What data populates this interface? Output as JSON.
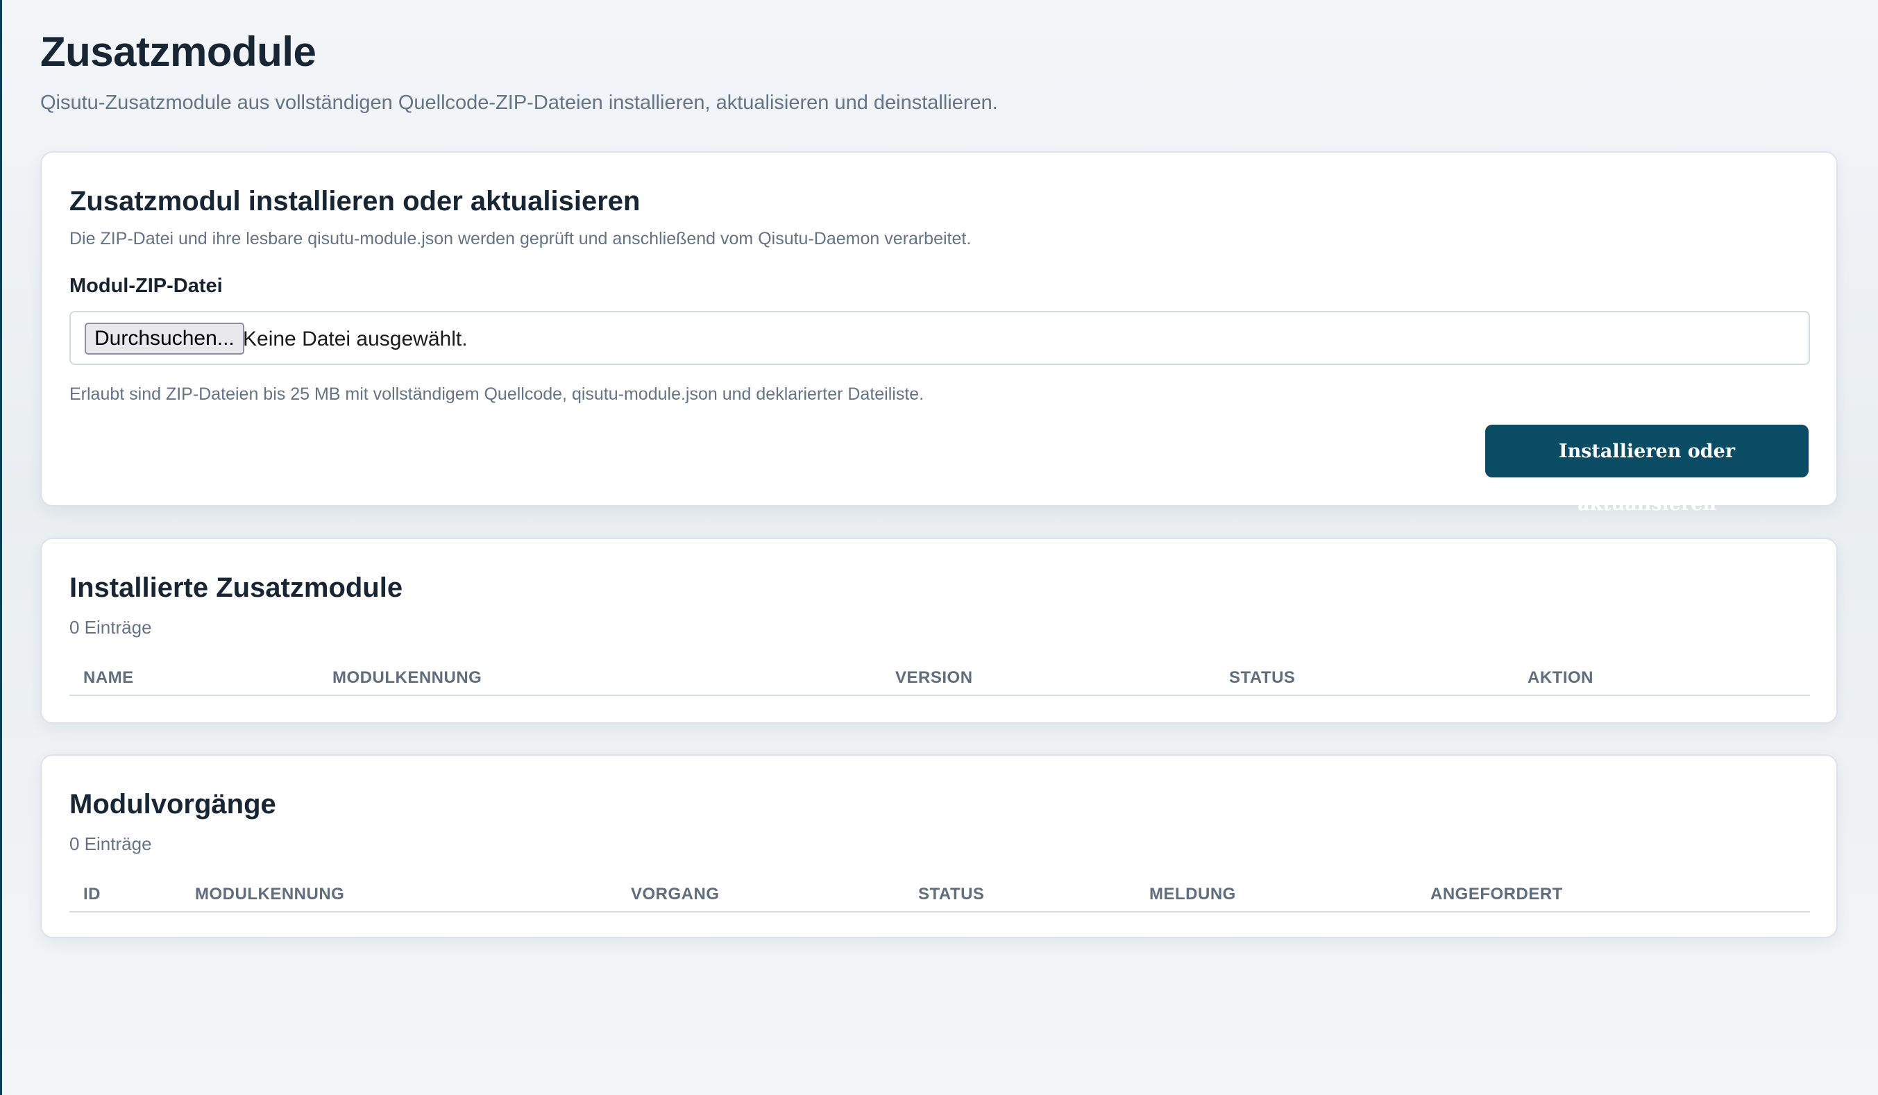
{
  "page": {
    "title": "Zusatzmodule",
    "subtitle": "Qisutu-Zusatzmodule aus vollständigen Quellcode-ZIP-Dateien installieren, aktualisieren und deinstallieren."
  },
  "install": {
    "title": "Zusatzmodul installieren oder aktualisieren",
    "description": "Die ZIP-Datei und ihre lesbare qisutu-module.json werden geprüft und anschließend vom Qisutu-Daemon verarbeitet.",
    "field_label": "Modul-ZIP-Datei",
    "browse_label": "Durchsuchen...",
    "file_status": "Keine Datei ausgewählt.",
    "hint": "Erlaubt sind ZIP-Dateien bis 25 MB mit vollständigem Quellcode, qisutu-module.json und deklarierter Dateiliste.",
    "submit_label": "Installieren oder aktualisieren"
  },
  "installed": {
    "title": "Installierte Zusatzmodule",
    "count": "0 Einträge",
    "columns": [
      "NAME",
      "MODULKENNUNG",
      "VERSION",
      "STATUS",
      "AKTION"
    ],
    "rows": []
  },
  "operations": {
    "title": "Modulvorgänge",
    "count": "0 Einträge",
    "columns": [
      "ID",
      "MODULKENNUNG",
      "VORGANG",
      "STATUS",
      "MELDUNG",
      "ANGEFORDERT"
    ],
    "rows": []
  },
  "colors": {
    "accent": "#094c64",
    "background": "#eef2f5",
    "card": "#ffffff",
    "muted_text": "#657383"
  }
}
